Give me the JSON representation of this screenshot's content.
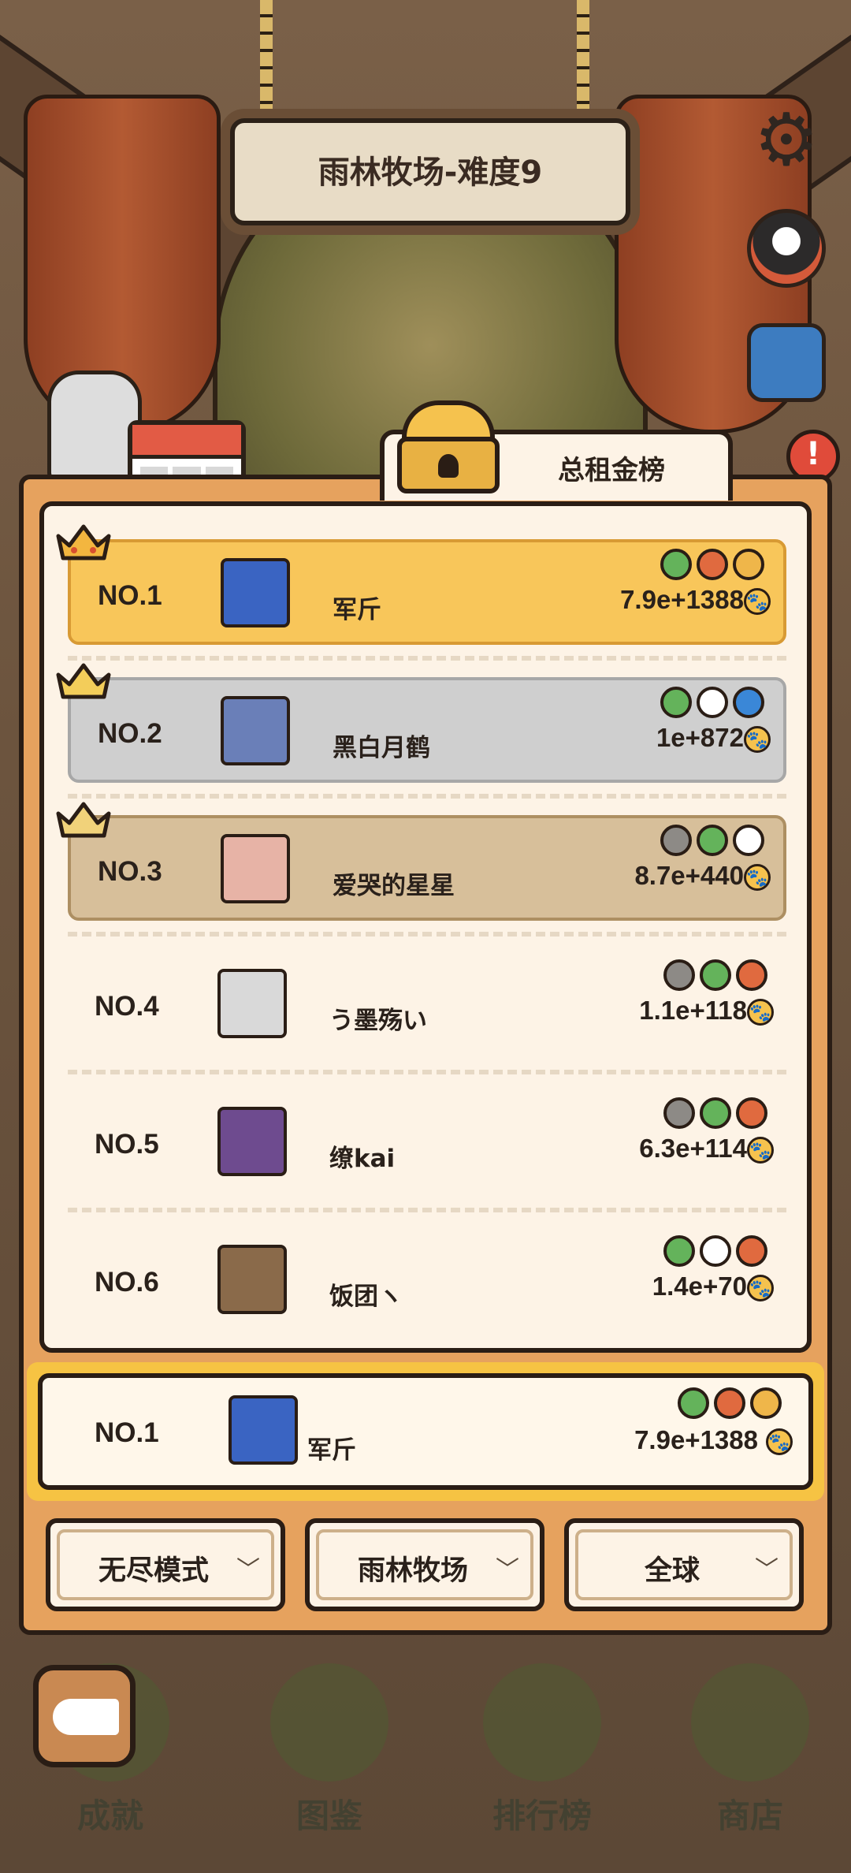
{
  "header": {
    "title": "雨林牧场-难度9"
  },
  "tab": {
    "label": "总租金榜"
  },
  "leaderboard": [
    {
      "rank": "NO.1",
      "name": "军斤",
      "score": "7.9e+1388",
      "tier": "gold",
      "badges": [
        "b-green",
        "b-red",
        "b-gold"
      ],
      "avatar_color": "#3a64c2"
    },
    {
      "rank": "NO.2",
      "name": "黑白月鹤",
      "score": "1e+872",
      "tier": "silver",
      "badges": [
        "b-green",
        "b-white",
        "b-blue"
      ],
      "avatar_color": "#6a7fb8"
    },
    {
      "rank": "NO.3",
      "name": "爱哭的星星",
      "score": "8.7e+440",
      "tier": "bronze",
      "badges": [
        "b-gray",
        "b-green",
        "b-white"
      ],
      "avatar_color": "#e7b3a6"
    },
    {
      "rank": "NO.4",
      "name": "う墨殇い",
      "score": "1.1e+118",
      "tier": "plain",
      "badges": [
        "b-gray",
        "b-green",
        "b-red"
      ],
      "avatar_color": "#d9d9d9"
    },
    {
      "rank": "NO.5",
      "name": "缭kai",
      "score": "6.3e+114",
      "tier": "plain",
      "badges": [
        "b-gray",
        "b-green",
        "b-red"
      ],
      "avatar_color": "#6e4b8f"
    },
    {
      "rank": "NO.6",
      "name": "饭团ヽ",
      "score": "1.4e+70",
      "tier": "plain",
      "badges": [
        "b-green",
        "b-white",
        "b-red"
      ],
      "avatar_color": "#8a6a4a"
    }
  ],
  "me": {
    "rank": "NO.1",
    "name": "军斤",
    "score": "7.9e+1388"
  },
  "filters": {
    "mode": "无尽模式",
    "map": "雨林牧场",
    "region": "全球",
    "chevron": "﹀"
  },
  "nav": {
    "achievements": "成就",
    "collection": "图鉴",
    "ranking": "排行榜",
    "shop": "商店"
  },
  "icons": {
    "settings": "⚙",
    "alert": "!",
    "paw": "🐾"
  }
}
